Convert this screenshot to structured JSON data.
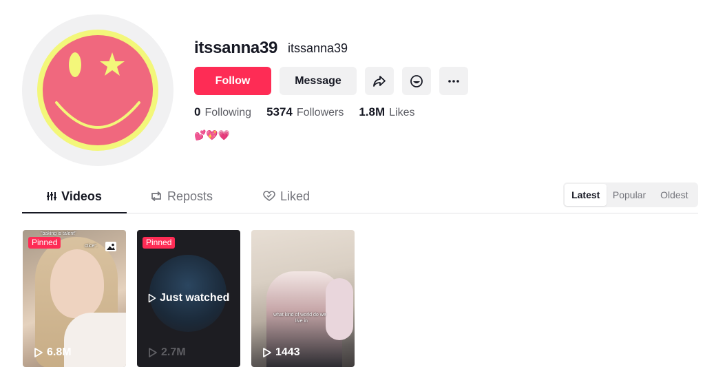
{
  "profile": {
    "username": "itssanna39",
    "nickname": "itssanna39",
    "bio": "💕💖💗",
    "avatar_colors": {
      "ring": "#f3f77a",
      "face": "#f0687e",
      "features": "#f3f77a"
    }
  },
  "actions": {
    "follow_label": "Follow",
    "message_label": "Message",
    "share_icon": "share-arrow-icon",
    "emoji_icon": "emoji-face-icon",
    "more_icon": "more-dots-icon"
  },
  "stats": {
    "following_count": "0",
    "following_label": "Following",
    "followers_count": "5374",
    "followers_label": "Followers",
    "likes_count": "1.8M",
    "likes_label": "Likes"
  },
  "tabs": [
    {
      "label": "Videos",
      "icon": "grid-bars-icon",
      "active": true
    },
    {
      "label": "Reposts",
      "icon": "repost-icon",
      "active": false
    },
    {
      "label": "Liked",
      "icon": "heart-outline-icon",
      "active": false
    }
  ],
  "sort": {
    "options": [
      "Latest",
      "Popular",
      "Oldest"
    ],
    "selected": "Latest"
  },
  "videos": [
    {
      "pinned": true,
      "pinned_label": "Pinned",
      "plays": "6.8M",
      "overlay_top": "\"baking is talent\"",
      "overlay_sub": "ctice\".",
      "type": "photo"
    },
    {
      "pinned": true,
      "pinned_label": "Pinned",
      "plays": "2.7M",
      "center_label": "Just watched"
    },
    {
      "pinned": false,
      "plays": "1443",
      "overlay_mid": "what kind of world do we",
      "overlay_mid2": "live in"
    }
  ],
  "colors": {
    "accent": "#fe2c55",
    "text_primary": "#161823",
    "text_secondary": "#73747b",
    "button_bg": "#f1f1f2"
  }
}
